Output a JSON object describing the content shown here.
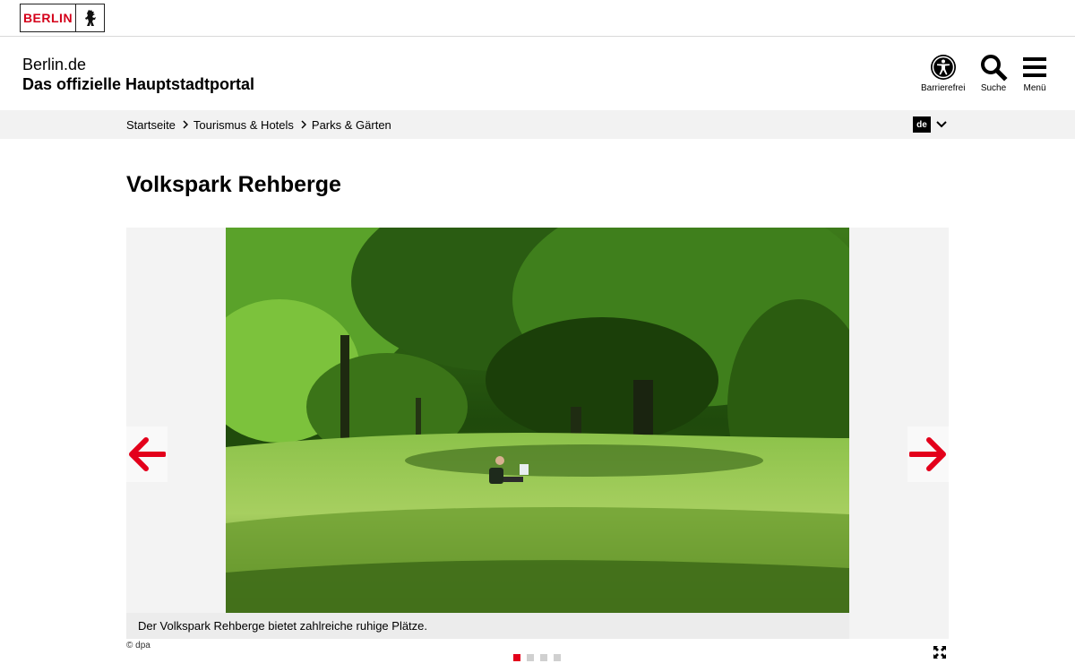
{
  "logo": {
    "text": "BERLIN"
  },
  "header": {
    "site_name": "Berlin.de",
    "site_claim": "Das offizielle Hauptstadtportal",
    "buttons": {
      "accessibility": "Barrierefrei",
      "search": "Suche",
      "menu": "Menü"
    }
  },
  "breadcrumb": [
    "Startseite",
    "Tourismus & Hotels",
    "Parks & Gärten"
  ],
  "language": {
    "selected": "de"
  },
  "page_title": "Volkspark Rehberge",
  "gallery": {
    "caption": "Der Volkspark Rehberge bietet zahlreiche ruhige Plätze.",
    "credit": "© dpa",
    "slide_count": 4,
    "active_slide": 1
  },
  "colors": {
    "accent_red": "#e3001b",
    "logo_red": "#d4001a",
    "breadcrumb_bg": "#f2f2f2"
  },
  "icons": [
    "bear-icon",
    "accessibility-icon",
    "search-icon",
    "menu-icon",
    "chevron-right-icon",
    "chevron-down-icon",
    "arrow-left-icon",
    "arrow-right-icon",
    "fullscreen-icon"
  ]
}
